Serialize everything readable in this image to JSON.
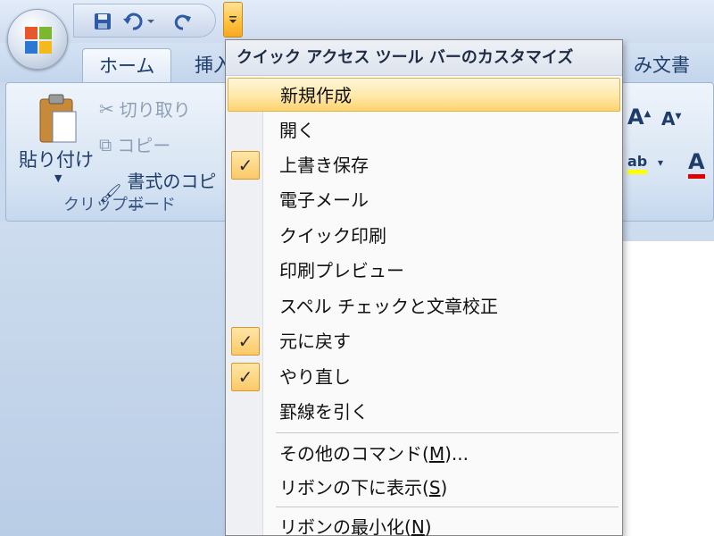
{
  "tabs": {
    "home": "ホーム",
    "insert": "挿入",
    "review": "み文書"
  },
  "clipboard": {
    "paste": "貼り付け",
    "cut": "切り取り",
    "copy": "コピー",
    "format_painter": "書式のコピー",
    "group_label": "クリップボード"
  },
  "menu": {
    "title": "クイック アクセス ツール バーのカスタマイズ",
    "items": [
      {
        "label": "新規作成",
        "checked": false,
        "highlighted": true
      },
      {
        "label": "開く",
        "checked": false
      },
      {
        "label": "上書き保存",
        "checked": true
      },
      {
        "label": "電子メール",
        "checked": false
      },
      {
        "label": "クイック印刷",
        "checked": false
      },
      {
        "label": "印刷プレビュー",
        "checked": false
      },
      {
        "label": "スペル チェックと文章校正",
        "checked": false
      },
      {
        "label": "元に戻す",
        "checked": true
      },
      {
        "label": "やり直し",
        "checked": true
      },
      {
        "label": "罫線を引く",
        "checked": false
      }
    ],
    "more_commands": {
      "text": "その他のコマンド(",
      "key": "M",
      "suffix": ")..."
    },
    "show_below": {
      "text": "リボンの下に表示(",
      "key": "S",
      "suffix": ")"
    },
    "minimize": {
      "text": "リボンの最小化(",
      "key": "N",
      "suffix": ")"
    }
  },
  "check_glyph": "✓",
  "colors": {
    "highlight": "#ffe8a8",
    "check_bg": "#fcc969",
    "ribbon_text": "#1f3d6b"
  }
}
